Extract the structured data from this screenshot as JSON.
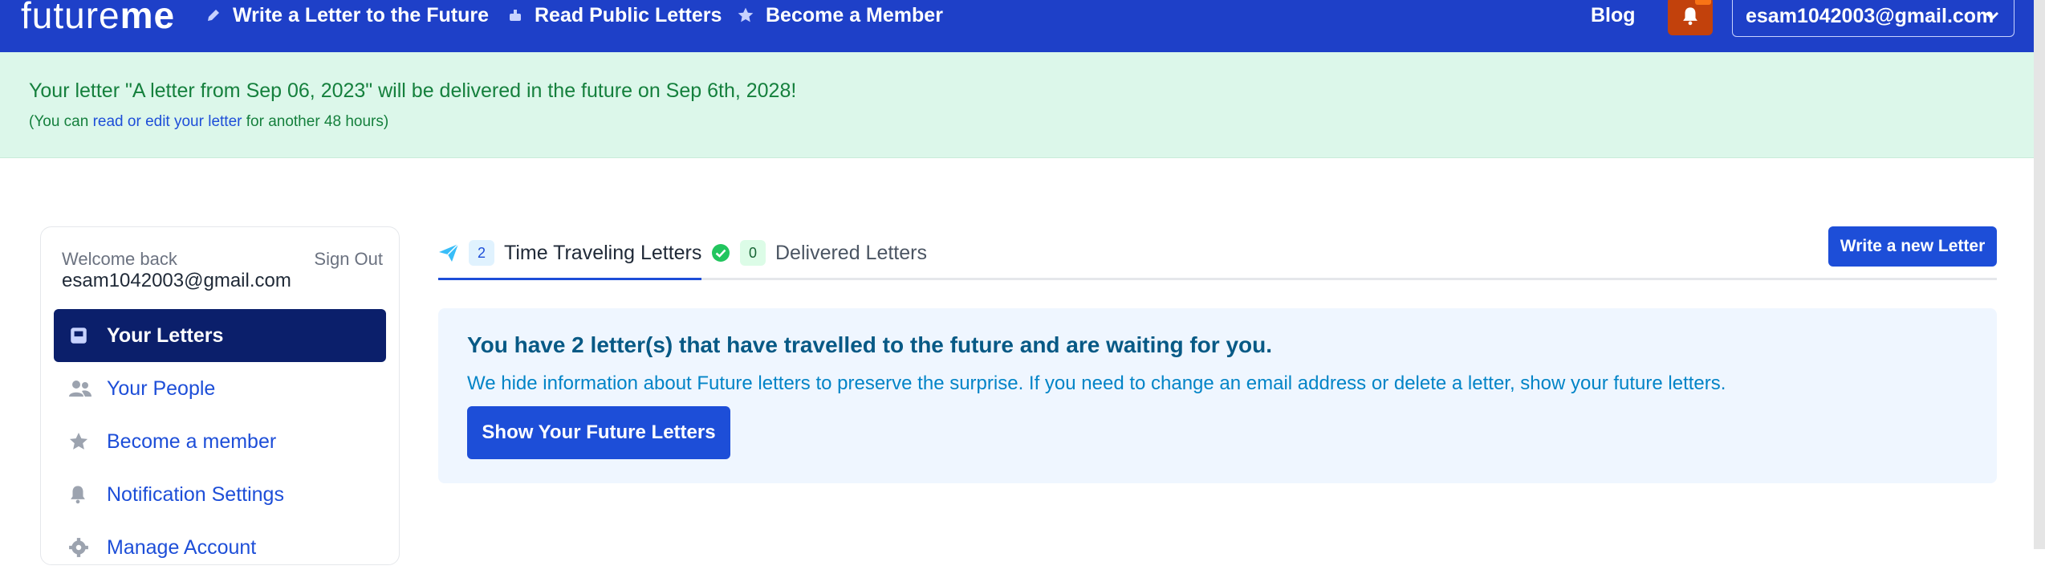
{
  "nav": {
    "logo_future": "future",
    "logo_me": "me",
    "links": [
      {
        "label": "Write a Letter to the Future",
        "icon": "pencil-icon"
      },
      {
        "label": "Read Public Letters",
        "icon": "mailbox-icon"
      },
      {
        "label": "Become a Member",
        "icon": "star-icon"
      }
    ],
    "blog": "Blog",
    "account_email": "esam1042003@gmail.com"
  },
  "banner": {
    "message": "Your letter \"A letter from Sep 06, 2023\" will be delivered in the future on Sep 6th, 2028!",
    "sub_prefix": "(You can ",
    "sub_link": "read or edit your letter",
    "sub_suffix": " for another 48 hours)"
  },
  "sidebar": {
    "welcome": "Welcome back",
    "sign_out": "Sign Out",
    "email": "esam1042003@gmail.com",
    "items": [
      {
        "label": "Your Letters",
        "icon": "inbox-icon",
        "active": true
      },
      {
        "label": "Your People",
        "icon": "people-icon"
      },
      {
        "label": "Become a member",
        "icon": "star-icon"
      },
      {
        "label": "Notification Settings",
        "icon": "bell-icon"
      },
      {
        "label": "Manage Account",
        "icon": "gear-icon"
      }
    ]
  },
  "tabs": [
    {
      "count": "2",
      "label": "Time Traveling Letters",
      "icon": "paper-plane-icon",
      "active": true
    },
    {
      "count": "0",
      "label": "Delivered Letters",
      "icon": "check-circle-icon"
    }
  ],
  "actions": {
    "write_new": "Write a new Letter"
  },
  "info": {
    "title": "You have 2 letter(s) that have travelled to the future and are waiting for you.",
    "text": "We hide information about Future letters to preserve the surprise. If you need to change an email address or delete a letter, show your future letters.",
    "button": "Show Your Future Letters"
  },
  "colors": {
    "nav_bg": "#1e40c8",
    "banner_bg": "#dcf7ea",
    "active_side": "#0b1f6b",
    "primary_button": "#1d4ed8",
    "bell_button": "#c2410c"
  }
}
